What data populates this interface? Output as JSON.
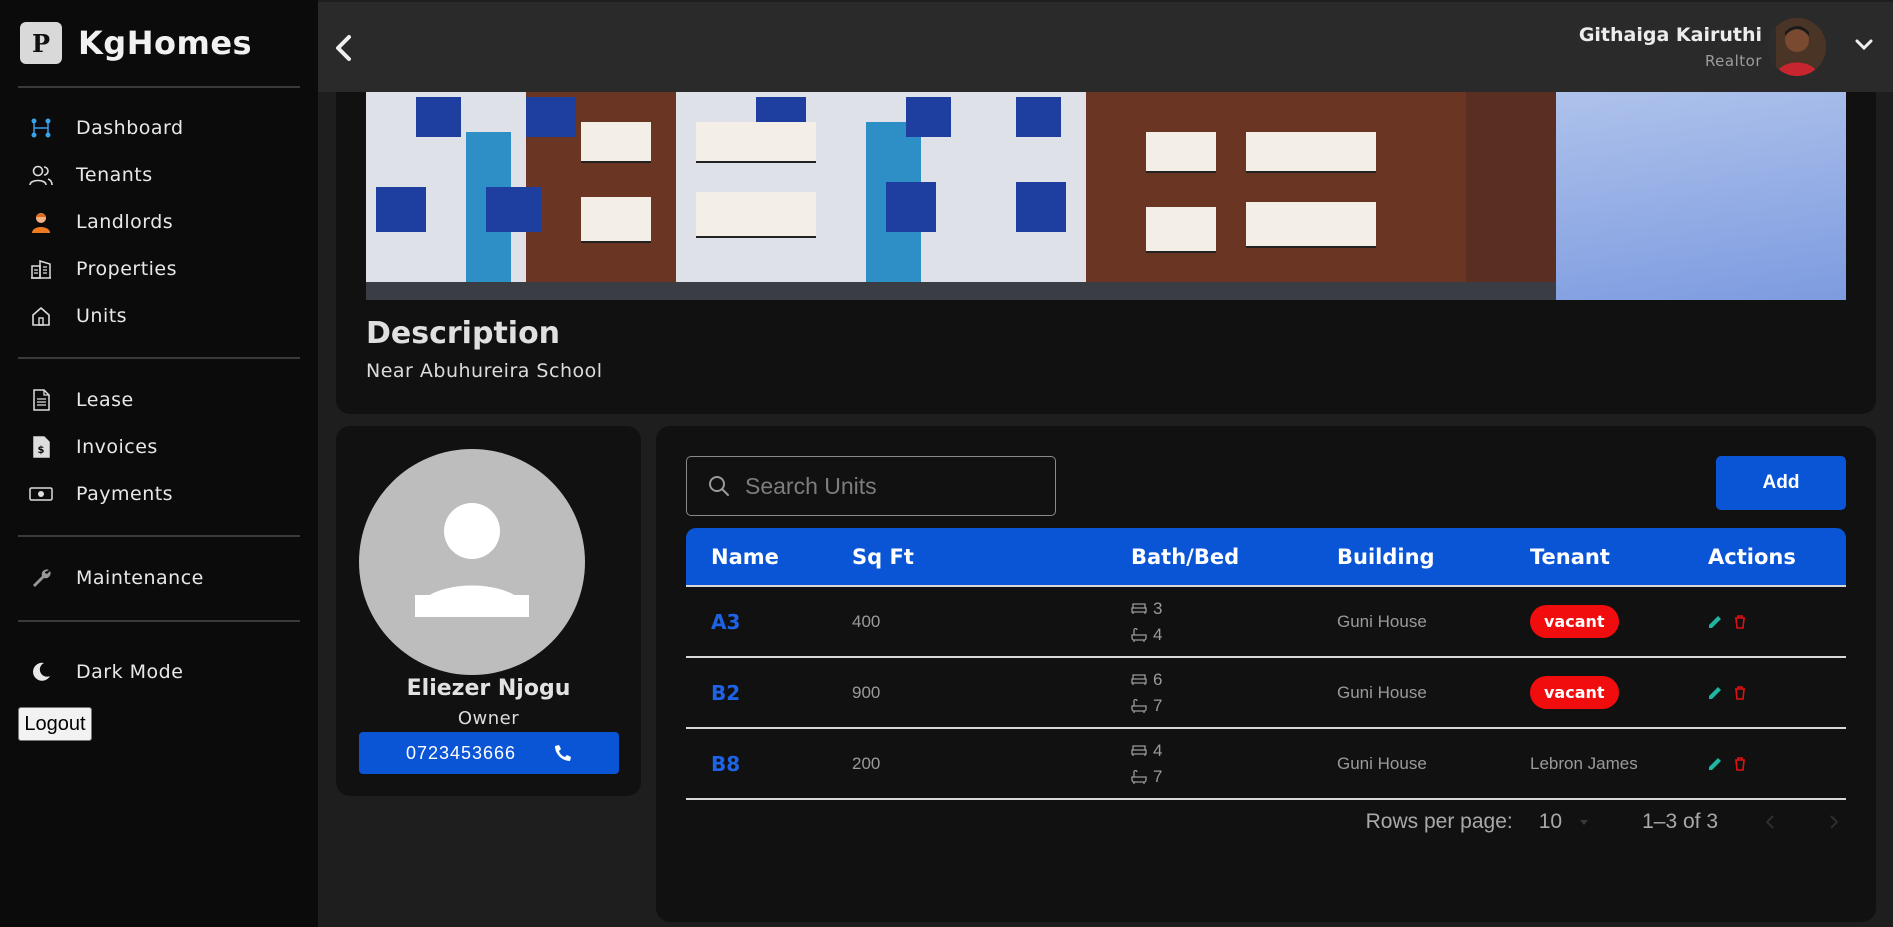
{
  "brand": {
    "logo_letter": "P",
    "name": "KgHomes"
  },
  "nav": {
    "dashboard": "Dashboard",
    "tenants": "Tenants",
    "landlords": "Landlords",
    "properties": "Properties",
    "units": "Units",
    "lease": "Lease",
    "invoices": "Invoices",
    "payments": "Payments",
    "maintenance": "Maintenance",
    "dark_mode": "Dark Mode",
    "logout": "Logout"
  },
  "user": {
    "name": "Githaiga Kairuthi",
    "role": "Realtor"
  },
  "property": {
    "description_title": "Description",
    "description": "Near Abuhureira School"
  },
  "owner": {
    "name": "Eliezer Njogu",
    "role": "Owner",
    "phone": "0723453666"
  },
  "units": {
    "search_placeholder": "Search Units",
    "add_label": "Add",
    "columns": [
      "Name",
      "Sq Ft",
      "Bath/Bed",
      "Building",
      "Tenant",
      "Actions"
    ],
    "rows": [
      {
        "name": "A3",
        "sqft": "400",
        "bath": "3",
        "bed": "4",
        "building": "Guni House",
        "tenant": "vacant",
        "vacant": true
      },
      {
        "name": "B2",
        "sqft": "900",
        "bath": "6",
        "bed": "7",
        "building": "Guni House",
        "tenant": "vacant",
        "vacant": true
      },
      {
        "name": "B8",
        "sqft": "200",
        "bath": "4",
        "bed": "7",
        "building": "Guni House",
        "tenant": "Lebron James",
        "vacant": false
      }
    ],
    "pagination": {
      "rows_per_page_label": "Rows per page:",
      "rows_per_page": "10",
      "range": "1–3 of 3"
    }
  },
  "colors": {
    "accent": "#0a55d6",
    "vacant": "#f10d0d",
    "edit": "#1fb5a0",
    "delete": "#e01010"
  }
}
